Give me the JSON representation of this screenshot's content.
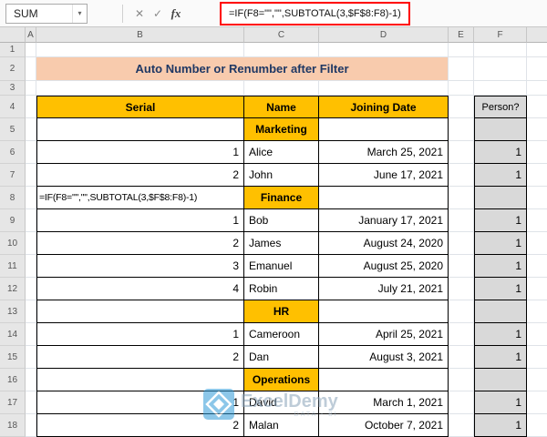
{
  "toolbar": {
    "name_box": "SUM",
    "dropdown_icon": "▾",
    "cancel_label": "✕",
    "enter_label": "✓",
    "fx_label": "fx",
    "formula": "=IF(F8=\"\",\"\",SUBTOTAL(3,$F$8:F8)-1)"
  },
  "colors": {
    "accent_gold": "#FFC000",
    "banner_peach": "#F8CBAD",
    "banner_text_navy": "#1F3864",
    "person_gray": "#D9D9D9",
    "highlight_red": "#FF0000"
  },
  "watermark": {
    "brand": "ExcelDemy",
    "tagline": "DATA - BI"
  },
  "sheet": {
    "col_headers": [
      "A",
      "B",
      "C",
      "D",
      "E",
      "F"
    ],
    "rows": [
      {
        "n": "1",
        "cells": []
      },
      {
        "n": "2",
        "cells": [
          {
            "c": "B",
            "t": "banner",
            "v": "Auto Number or Renumber after Filter"
          }
        ]
      },
      {
        "n": "3",
        "cells": []
      },
      {
        "n": "4",
        "cells": [
          {
            "c": "B",
            "t": "header",
            "v": "Serial"
          },
          {
            "c": "C",
            "t": "header",
            "v": "Name"
          },
          {
            "c": "D",
            "t": "header",
            "v": "Joining Date"
          },
          {
            "c": "F",
            "t": "phead",
            "v": "Person?"
          }
        ]
      },
      {
        "n": "5",
        "cells": [
          {
            "c": "B",
            "t": "blank",
            "v": ""
          },
          {
            "c": "C",
            "t": "category",
            "v": "Marketing"
          },
          {
            "c": "D",
            "t": "blank",
            "v": ""
          },
          {
            "c": "F",
            "t": "pempty",
            "v": ""
          }
        ]
      },
      {
        "n": "6",
        "cells": [
          {
            "c": "B",
            "t": "serial",
            "v": "1"
          },
          {
            "c": "C",
            "t": "name",
            "v": "Alice"
          },
          {
            "c": "D",
            "t": "date",
            "v": "March 25, 2021"
          },
          {
            "c": "F",
            "t": "pval",
            "v": "1"
          }
        ]
      },
      {
        "n": "7",
        "cells": [
          {
            "c": "B",
            "t": "serial",
            "v": "2"
          },
          {
            "c": "C",
            "t": "name",
            "v": "John"
          },
          {
            "c": "D",
            "t": "date",
            "v": "June 17, 2021"
          },
          {
            "c": "F",
            "t": "pval",
            "v": "1"
          }
        ]
      },
      {
        "n": "8",
        "cells": [
          {
            "c": "B",
            "t": "formula",
            "v": "=IF(F8=\"\",\"\",SUBTOTAL(3,$F$8:F8)-1)"
          },
          {
            "c": "C",
            "t": "category",
            "v": "Finance"
          },
          {
            "c": "D",
            "t": "blank",
            "v": ""
          },
          {
            "c": "F",
            "t": "pempty",
            "v": ""
          }
        ]
      },
      {
        "n": "9",
        "cells": [
          {
            "c": "B",
            "t": "serial",
            "v": "1"
          },
          {
            "c": "C",
            "t": "name",
            "v": "Bob"
          },
          {
            "c": "D",
            "t": "date",
            "v": "January 17, 2021"
          },
          {
            "c": "F",
            "t": "pval",
            "v": "1"
          }
        ]
      },
      {
        "n": "10",
        "cells": [
          {
            "c": "B",
            "t": "serial",
            "v": "2"
          },
          {
            "c": "C",
            "t": "name",
            "v": "James"
          },
          {
            "c": "D",
            "t": "date",
            "v": "August 24, 2020"
          },
          {
            "c": "F",
            "t": "pval",
            "v": "1"
          }
        ]
      },
      {
        "n": "11",
        "cells": [
          {
            "c": "B",
            "t": "serial",
            "v": "3"
          },
          {
            "c": "C",
            "t": "name",
            "v": "Emanuel"
          },
          {
            "c": "D",
            "t": "date",
            "v": "August 25, 2020"
          },
          {
            "c": "F",
            "t": "pval",
            "v": "1"
          }
        ]
      },
      {
        "n": "12",
        "cells": [
          {
            "c": "B",
            "t": "serial",
            "v": "4"
          },
          {
            "c": "C",
            "t": "name",
            "v": "Robin"
          },
          {
            "c": "D",
            "t": "date",
            "v": "July 21, 2021"
          },
          {
            "c": "F",
            "t": "pval",
            "v": "1"
          }
        ]
      },
      {
        "n": "13",
        "cells": [
          {
            "c": "B",
            "t": "blank",
            "v": ""
          },
          {
            "c": "C",
            "t": "category",
            "v": "HR"
          },
          {
            "c": "D",
            "t": "blank",
            "v": ""
          },
          {
            "c": "F",
            "t": "pempty",
            "v": ""
          }
        ]
      },
      {
        "n": "14",
        "cells": [
          {
            "c": "B",
            "t": "serial",
            "v": "1"
          },
          {
            "c": "C",
            "t": "name",
            "v": "Cameroon"
          },
          {
            "c": "D",
            "t": "date",
            "v": "April 25, 2021"
          },
          {
            "c": "F",
            "t": "pval",
            "v": "1"
          }
        ]
      },
      {
        "n": "15",
        "cells": [
          {
            "c": "B",
            "t": "serial",
            "v": "2"
          },
          {
            "c": "C",
            "t": "name",
            "v": "Dan"
          },
          {
            "c": "D",
            "t": "date",
            "v": "August 3, 2021"
          },
          {
            "c": "F",
            "t": "pval",
            "v": "1"
          }
        ]
      },
      {
        "n": "16",
        "cells": [
          {
            "c": "B",
            "t": "blank",
            "v": ""
          },
          {
            "c": "C",
            "t": "category",
            "v": "Operations"
          },
          {
            "c": "D",
            "t": "blank",
            "v": ""
          },
          {
            "c": "F",
            "t": "pempty",
            "v": ""
          }
        ]
      },
      {
        "n": "17",
        "cells": [
          {
            "c": "B",
            "t": "serial",
            "v": "1"
          },
          {
            "c": "C",
            "t": "name",
            "v": "David"
          },
          {
            "c": "D",
            "t": "date",
            "v": "March 1, 2021"
          },
          {
            "c": "F",
            "t": "pval",
            "v": "1"
          }
        ]
      },
      {
        "n": "18",
        "cells": [
          {
            "c": "B",
            "t": "serial",
            "v": "2"
          },
          {
            "c": "C",
            "t": "name",
            "v": "Malan"
          },
          {
            "c": "D",
            "t": "date",
            "v": "October 7, 2021"
          },
          {
            "c": "F",
            "t": "pval",
            "v": "1"
          }
        ]
      }
    ]
  }
}
